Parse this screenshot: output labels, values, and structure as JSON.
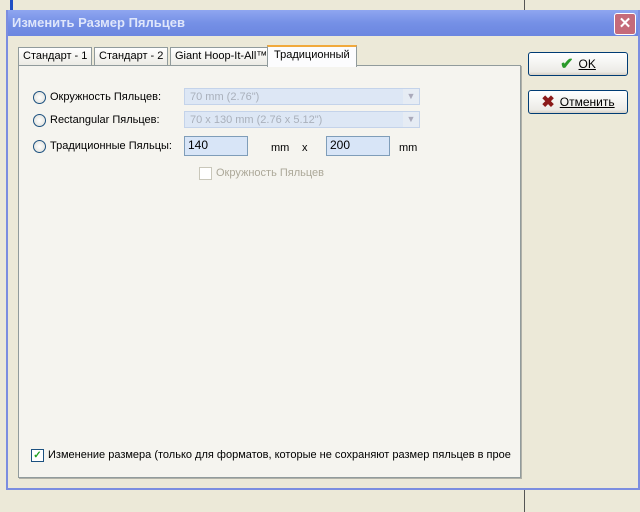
{
  "dialog": {
    "title": "Изменить  Размер Пяльцев",
    "close_icon": "close-icon"
  },
  "tabs": [
    {
      "label": "Стандарт - 1"
    },
    {
      "label": "Стандарт - 2"
    },
    {
      "label": "Giant Hoop-It-All™"
    },
    {
      "label": "Традиционный",
      "active": true
    }
  ],
  "options": {
    "round": {
      "label": "Окружность Пяльцев:",
      "value": "70 mm (2.76\")"
    },
    "rect": {
      "label": "Rectangular Пяльцев:",
      "value": "70 x 130 mm (2.76 x 5.12\")"
    },
    "trad": {
      "label": "Традиционные Пяльцы:",
      "width": "140",
      "height": "200",
      "unit": "mm",
      "sep": "x"
    },
    "round_check": {
      "label": "Окружность Пяльцев",
      "checked": false
    }
  },
  "resize": {
    "label": "Изменение размера (только для форматов, которые не сохраняют размер пяльцев в прое",
    "checked": true
  },
  "buttons": {
    "ok": "OK",
    "cancel": "Отменить"
  },
  "colors": {
    "title": "#7590e6",
    "ok_check": "#2a9a2a",
    "cancel_x": "#8b1a1a"
  }
}
